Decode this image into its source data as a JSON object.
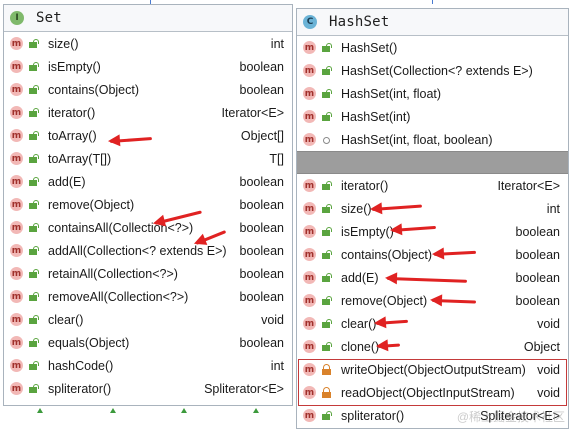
{
  "colors": {
    "accent_red": "#e02222",
    "method_icon_bg": "#f2b8b6",
    "public_green": "#5aa43f",
    "private_orange": "#d9822b",
    "separator_gray": "#9d9d9d"
  },
  "left": {
    "kind": "I",
    "title": "Set",
    "rows": [
      {
        "icon": "m",
        "vis": "public",
        "sig": "size()",
        "ret": "int"
      },
      {
        "icon": "m",
        "vis": "public",
        "sig": "isEmpty()",
        "ret": "boolean"
      },
      {
        "icon": "m",
        "vis": "public",
        "sig": "contains(Object)",
        "ret": "boolean"
      },
      {
        "icon": "m",
        "vis": "public",
        "sig": "iterator()",
        "ret": "Iterator<E>"
      },
      {
        "icon": "m",
        "vis": "public",
        "sig": "toArray()",
        "ret": "Object[]"
      },
      {
        "icon": "m",
        "vis": "public",
        "sig": "toArray(T[])",
        "ret": "T[]"
      },
      {
        "icon": "m",
        "vis": "public",
        "sig": "add(E)",
        "ret": "boolean"
      },
      {
        "icon": "m",
        "vis": "public",
        "sig": "remove(Object)",
        "ret": "boolean"
      },
      {
        "icon": "m",
        "vis": "public",
        "sig": "containsAll(Collection<?>)",
        "ret": "boolean"
      },
      {
        "icon": "m",
        "vis": "public",
        "sig": "addAll(Collection<? extends E>)",
        "ret": "boolean"
      },
      {
        "icon": "m",
        "vis": "public",
        "sig": "retainAll(Collection<?>)",
        "ret": "boolean"
      },
      {
        "icon": "m",
        "vis": "public",
        "sig": "removeAll(Collection<?>)",
        "ret": "boolean"
      },
      {
        "icon": "m",
        "vis": "public",
        "sig": "clear()",
        "ret": "void"
      },
      {
        "icon": "m",
        "vis": "public",
        "sig": "equals(Object)",
        "ret": "boolean"
      },
      {
        "icon": "m",
        "vis": "public",
        "sig": "hashCode()",
        "ret": "int"
      },
      {
        "icon": "m",
        "vis": "public",
        "sig": "spliterator()",
        "ret": "Spliterator<E>"
      }
    ]
  },
  "right": {
    "kind": "C",
    "title": "HashSet",
    "constructors": [
      {
        "icon": "m",
        "vis": "public",
        "sig": "HashSet()",
        "ret": ""
      },
      {
        "icon": "m",
        "vis": "public",
        "sig": "HashSet(Collection<? extends E>)",
        "ret": ""
      },
      {
        "icon": "m",
        "vis": "public",
        "sig": "HashSet(int, float)",
        "ret": ""
      },
      {
        "icon": "m",
        "vis": "public",
        "sig": "HashSet(int)",
        "ret": ""
      },
      {
        "icon": "m",
        "vis": "package",
        "sig": "HashSet(int, float, boolean)",
        "ret": ""
      }
    ],
    "methods": [
      {
        "icon": "m",
        "vis": "public",
        "sig": "iterator()",
        "ret": "Iterator<E>"
      },
      {
        "icon": "m",
        "vis": "public",
        "sig": "size()",
        "ret": "int"
      },
      {
        "icon": "m",
        "vis": "public",
        "sig": "isEmpty()",
        "ret": "boolean"
      },
      {
        "icon": "m",
        "vis": "public",
        "sig": "contains(Object)",
        "ret": "boolean"
      },
      {
        "icon": "m",
        "vis": "public",
        "sig": "add(E)",
        "ret": "boolean"
      },
      {
        "icon": "m",
        "vis": "public",
        "sig": "remove(Object)",
        "ret": "boolean"
      },
      {
        "icon": "m",
        "vis": "public",
        "sig": "clear()",
        "ret": "void"
      },
      {
        "icon": "m",
        "vis": "public",
        "sig": "clone()",
        "ret": "Object"
      },
      {
        "icon": "m",
        "vis": "private",
        "sig": "writeObject(ObjectOutputStream)",
        "ret": "void"
      },
      {
        "icon": "m",
        "vis": "private",
        "sig": "readObject(ObjectInputStream)",
        "ret": "void"
      },
      {
        "icon": "m",
        "vis": "public",
        "sig": "spliterator()",
        "ret": "Spliterator<E>"
      }
    ]
  },
  "watermark": "@稀土掘金技术社区"
}
